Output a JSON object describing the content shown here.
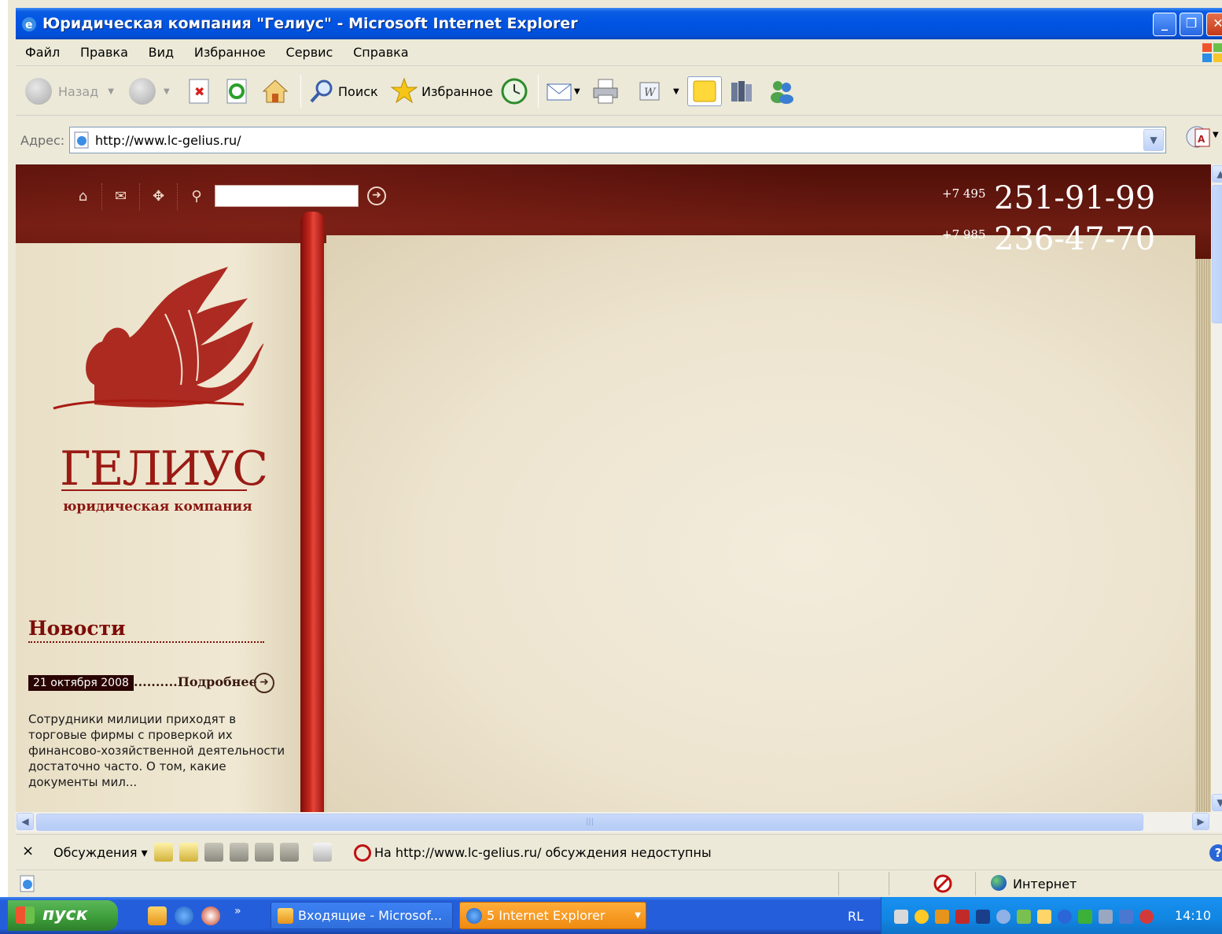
{
  "window": {
    "title": "Юридическая компания \"Гелиус\" - Microsoft Internet Explorer"
  },
  "menu": [
    "Файл",
    "Правка",
    "Вид",
    "Избранное",
    "Сервис",
    "Справка"
  ],
  "toolbar": {
    "back_label": "Назад",
    "search_label": "Поиск",
    "favorites_label": "Избранное"
  },
  "address": {
    "label": "Адрес:",
    "url": "http://www.lc-gelius.ru/"
  },
  "site": {
    "search_value": "",
    "phones": [
      {
        "code": "+7 495",
        "number": "251-91-99"
      },
      {
        "code": "+7 985",
        "number": "236-47-70"
      }
    ],
    "brand_name": "ГЕЛИУС",
    "brand_subtitle": "юридическая компания",
    "news": {
      "heading": "Новости",
      "date": "21 октября 2008",
      "more_label": "..........Подробнее",
      "text": "Сотрудники милиции приходят в торговые фирмы с проверкой их финансово-хозяйственной деятельности достаточно часто. О том, какие документы мил..."
    }
  },
  "discussions": {
    "close": "×",
    "label": "Обсуждения ▾",
    "message": "На http://www.lc-gelius.ru/ обсуждения недоступны"
  },
  "status": {
    "zone": "Интернет"
  },
  "taskbar": {
    "start_label": "пуск",
    "tasks": [
      {
        "label": "Входящие - Microsof..."
      },
      {
        "label": "5 Internet Explorer"
      }
    ],
    "language": "RL",
    "clock": "14:10"
  },
  "colors": {
    "xp_blue": "#0054e3",
    "site_burgundy": "#6e1c12",
    "brand_red": "#9a1a14",
    "ribbon_red": "#c8261c",
    "paper": "#efe7d5"
  }
}
